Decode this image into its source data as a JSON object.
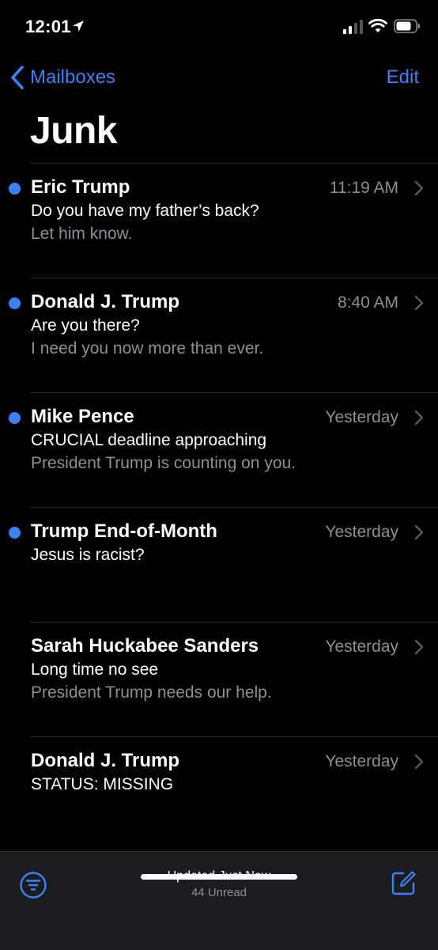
{
  "status_bar": {
    "time": "12:01",
    "icons": [
      "location-arrow-icon",
      "cellular-signal-icon",
      "wifi-icon",
      "battery-icon"
    ]
  },
  "nav": {
    "back_label": "Mailboxes",
    "edit_label": "Edit",
    "title": "Junk"
  },
  "messages": [
    {
      "sender": "Eric Trump",
      "time": "11:19 AM",
      "subject": "Do you have my father’s back?",
      "preview": "Let him know.",
      "unread": true
    },
    {
      "sender": "Donald J. Trump",
      "time": "8:40 AM",
      "subject": "Are you there?",
      "preview": "I need you now more than ever.",
      "unread": true
    },
    {
      "sender": "Mike Pence",
      "time": "Yesterday",
      "subject": "CRUCIAL deadline approaching",
      "preview": "President Trump is counting on you.",
      "unread": true
    },
    {
      "sender": "Trump End-of-Month",
      "time": "Yesterday",
      "subject": "Jesus is racist?",
      "preview": "",
      "unread": true
    },
    {
      "sender": "Sarah Huckabee Sanders",
      "time": "Yesterday",
      "subject": "Long time no see",
      "preview": "President Trump needs our help.",
      "unread": false
    },
    {
      "sender": "Donald J. Trump",
      "time": "Yesterday",
      "subject": "STATUS: MISSING",
      "preview": "",
      "unread": false
    }
  ],
  "toolbar": {
    "updated": "Updated Just Now",
    "unread_count": "44 Unread"
  },
  "colors": {
    "accent": "#3b82f6",
    "background": "#000000",
    "secondary_text": "#8e8e93"
  }
}
